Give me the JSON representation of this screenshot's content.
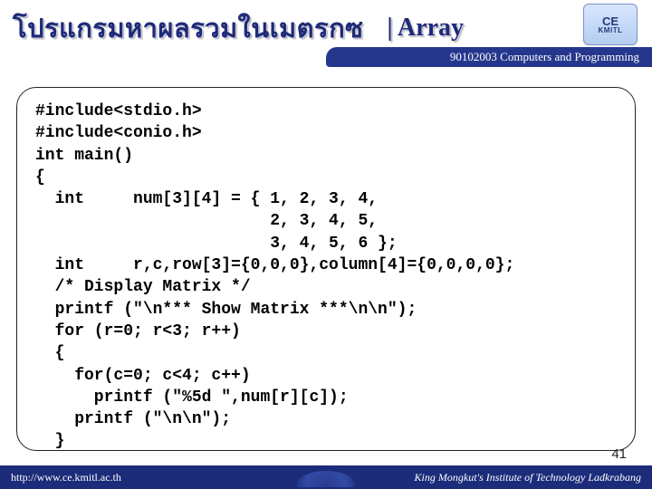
{
  "header": {
    "thai_title": "โปรแกรมหาผลรวมในเมตรกซ",
    "array_label": "| Array"
  },
  "logo": {
    "line1": "CE",
    "line2": "KMITL"
  },
  "sub_banner": "90102003 Computers and Programming",
  "code": "#include<stdio.h>\n#include<conio.h>\nint main()\n{\n  int     num[3][4] = { 1, 2, 3, 4,\n                        2, 3, 4, 5,\n                        3, 4, 5, 6 };\n  int     r,c,row[3]={0,0,0},column[4]={0,0,0,0};\n  /* Display Matrix */\n  printf (\"\\n*** Show Matrix ***\\n\\n\");\n  for (r=0; r<3; r++)\n  {\n    for(c=0; c<4; c++)\n      printf (\"%5d \",num[r][c]);\n    printf (\"\\n\\n\");\n  }",
  "page_number": "41",
  "footer": {
    "url": "http://www.ce.kmitl.ac.th",
    "org": "King Mongkut's Institute of Technology Ladkrabang"
  }
}
